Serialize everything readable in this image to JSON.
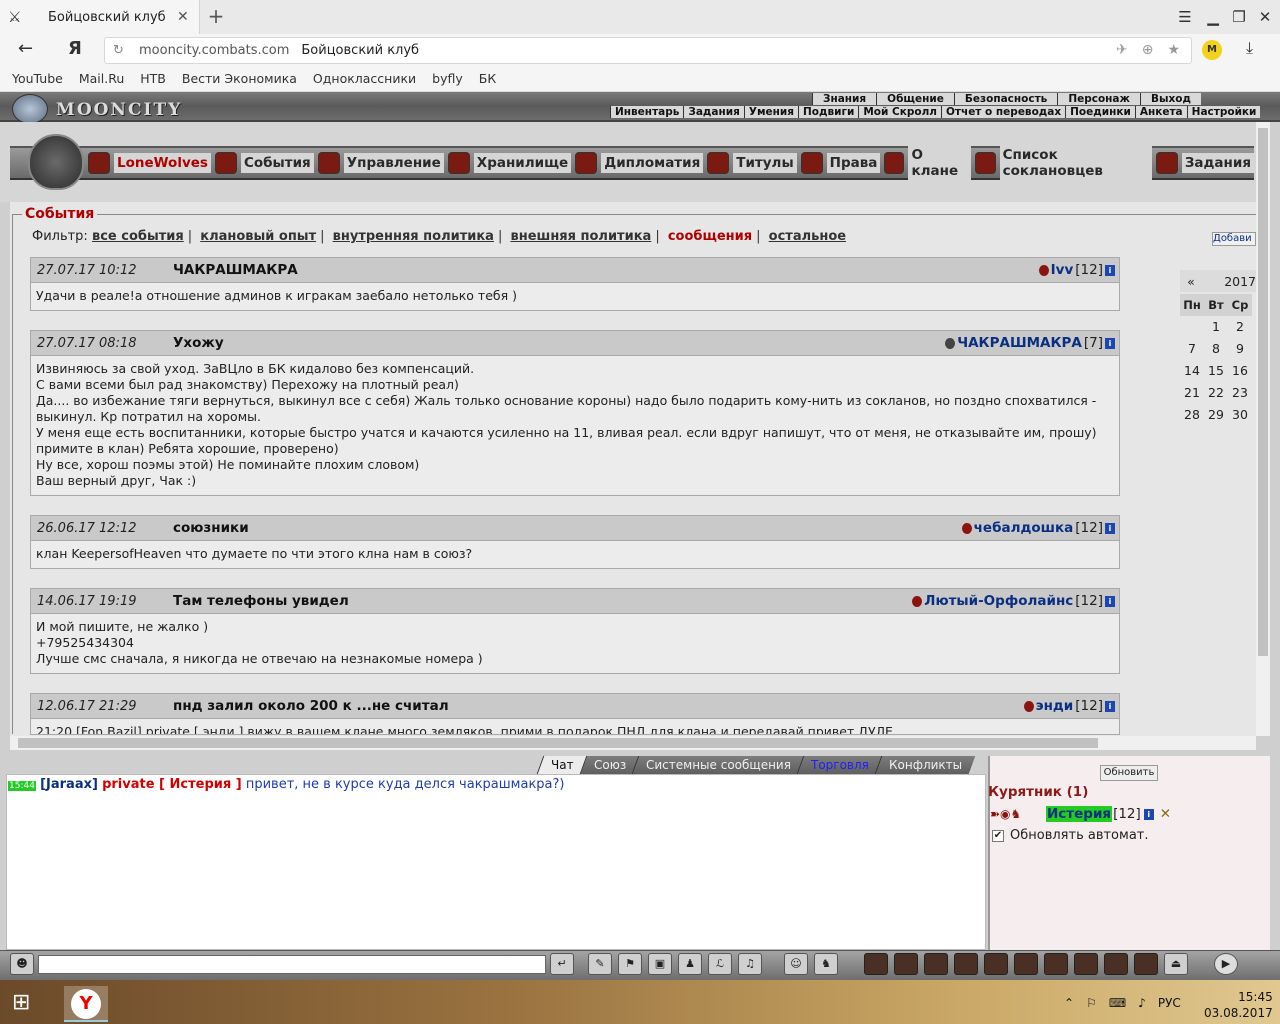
{
  "browser": {
    "tab_title": "Бойцовский клуб",
    "tab_close": "✕",
    "new_tab": "+",
    "back": "←",
    "logo": "Я",
    "url_domain": "mooncity.combats.com",
    "url_title": "Бойцовский клуб",
    "profile_letter": "M",
    "bookmarks": [
      "YouTube",
      "Mail.Ru",
      "НТВ",
      "Вести Экономика",
      "Одноклассники",
      "byfly",
      "БК"
    ]
  },
  "game": {
    "logo_text": "MOONCITY",
    "topnav_row1": [
      "Знания",
      "Общение",
      "Безопасность",
      "Персонаж",
      "Выход"
    ],
    "topnav_row2": [
      "Инвентарь",
      "Задания",
      "Умения",
      "Подвиги",
      "Мой Скролл",
      "Отчет о переводах",
      "Поединки",
      "Анкета",
      "Настройки"
    ],
    "clan_menu": [
      "LoneWolves",
      "События",
      "Управление",
      "Хранилище",
      "Дипломатия",
      "Титулы",
      "Права",
      "О клане",
      "Список соклановцев",
      "Задания"
    ]
  },
  "events": {
    "title": "События",
    "filter_label": "Фильтр:",
    "filters": [
      "все события",
      "клановый опыт",
      "внутренняя политика",
      "внешняя политика",
      "сообщения",
      "остальное"
    ],
    "active_filter": "сообщения",
    "add_button": "Добави",
    "messages": [
      {
        "date": "27.07.17 10:12",
        "title": "ЧАКРАШМАКРА",
        "author": "Ivv",
        "level": "[12]",
        "body": [
          "Удачи в реале!а отношение админов к игракам заебало нетолько тебя )"
        ]
      },
      {
        "date": "27.07.17 08:18",
        "title": "Ухожу",
        "author": "ЧАКРАШМАКРА",
        "level": "[7]",
        "body": [
          "Извиняюсь за свой уход. ЗаВЦло в БК кидалово без компенсаций.",
          "С вами всеми был рад знакомству) Перехожу на плотный реал)",
          "Да.... во избежание тяги вернуться, выкинул все с себя) Жаль только основание короны) надо было подарить кому-нить из сокланов, но поздно спохватился - выкинул. Кр потратил на хоромы.",
          "У меня еще есть воспитанники, которые быстро учатся и качаются усиленно на 11, вливая реал. если вдруг напишут, что от меня, не отказывайте им, прошу) примите в клан) Ребята хорошие, проверено)",
          "Ну все, хорош поэмы этой) Не поминайте плохим словом)",
          "Ваш верный друг, Чак :)"
        ]
      },
      {
        "date": "26.06.17 12:12",
        "title": "союзники",
        "author": "чебалдошка",
        "level": "[12]",
        "body": [
          "клан KeepersofHeaven что думаете по чти этого клна нам в союз?"
        ]
      },
      {
        "date": "14.06.17 19:19",
        "title": "Там телефоны увидел",
        "author": "Лютый-Орфолайнс",
        "level": "[12]",
        "body": [
          "И мой пишите, не жалко )",
          "+79525434304",
          "Лучше смс сначала, я никогда не отвечаю на незнакомые номера )"
        ]
      },
      {
        "date": "12.06.17 21:29",
        "title": "пнд залил около 200 к ...не считал",
        "author": "энди",
        "level": "[12]",
        "body": [
          "21:20 [Fon Bazil] private [ энди ] вижу в вашем клане много земляков, прими в подарок ПНД для клана и передавай привет ДУЛЕ"
        ]
      }
    ]
  },
  "calendar": {
    "prev": "«",
    "year": "2017",
    "weekdays": [
      "Пн",
      "Вт",
      "Ср"
    ],
    "days": [
      "",
      "1",
      "2",
      "7",
      "8",
      "9",
      "14",
      "15",
      "16",
      "21",
      "22",
      "23",
      "28",
      "29",
      "30"
    ]
  },
  "chat": {
    "tabs": [
      "Чат",
      "Союз",
      "Системные сообщения",
      "Торговля",
      "Конфликты"
    ],
    "active_tab": "Чат",
    "line": {
      "time": "15:44",
      "nick": "[Jaraax]",
      "private": "private [ Истерия ]",
      "text": "привет, не в курсе куда делся чакрашмакра?)"
    }
  },
  "online": {
    "refresh": "Обновить",
    "room": "Курятник (1)",
    "user": "Истерия",
    "user_level": "[12]",
    "autorefresh": "Обновлять автомат."
  },
  "taskbar": {
    "lang": "РУС",
    "time": "15:45",
    "date": "03.08.2017"
  }
}
